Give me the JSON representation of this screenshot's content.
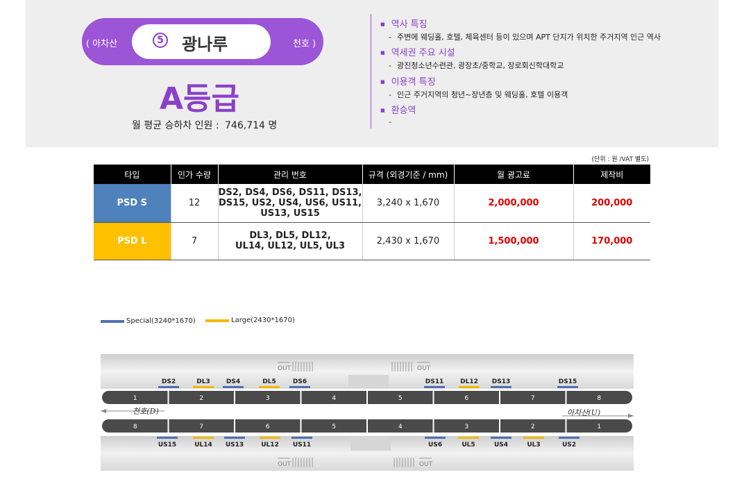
{
  "station": {
    "prev_station": "( 아차산",
    "next_station": "천호 )",
    "number": "5",
    "name": "광나루",
    "grade": "A등급",
    "monthly_riders_label": "월 평균 승하차 인원 :",
    "monthly_riders_value": "746,714 명"
  },
  "info": [
    {
      "title": "역사 특징",
      "desc": "주변에 웨딩홀, 호텔, 체육센터 등이 있으며 APT 단지가 위치한 주거지역 인근 역사"
    },
    {
      "title": "역세권 주요 시설",
      "desc": "광진청소년수련관, 광장초/중학교, 장로회신학대학교"
    },
    {
      "title": "이용객 특징",
      "desc": "인근 주거지역의 청년~장년층 및 웨딩홀, 호텔 이용객"
    },
    {
      "title": "환승역",
      "desc": ""
    }
  ],
  "table": {
    "unit_note": "(단위 : 원 /VAT 별도)",
    "headers": [
      "타입",
      "인가 수량",
      "관리 번호",
      "규격 (외경기준 / mm)",
      "월 광고료",
      "제작비"
    ],
    "rows": [
      {
        "type": "PSD S",
        "qty": "12",
        "codes_1": "DS2, DS4, DS6, DS11, DS13,",
        "codes_2": "DS15, US2, US4, US6, US11,",
        "codes_3": "US13, US15",
        "size": "3,240 x 1,670",
        "monthly_fee": "2,000,000",
        "production_fee": "200,000"
      },
      {
        "type": "PSD L",
        "qty": "7",
        "codes_1": "DL3, DL5, DL12,",
        "codes_2": "UL14, UL12, UL5, UL3",
        "codes_3": "",
        "size": "2,430 x 1,670",
        "monthly_fee": "1,500,000",
        "production_fee": "170,000"
      }
    ]
  },
  "legend": {
    "special": "Special(3240*1670)",
    "large": "Large(2430*1670)",
    "special_color": "#4f6fb0",
    "large_color": "#f5b800"
  },
  "diagram": {
    "out_label": "OUT",
    "dir_down": "천호(D)",
    "dir_up": "아차산(U)",
    "top_labels": [
      {
        "label": "DS2",
        "kind": "special"
      },
      {
        "label": "DL3",
        "kind": "large"
      },
      {
        "label": "DS4",
        "kind": "special"
      },
      {
        "label": "DL5",
        "kind": "large"
      },
      {
        "label": "DS6",
        "kind": "special"
      },
      {
        "label": "DS11",
        "kind": "special"
      },
      {
        "label": "DL12",
        "kind": "large"
      },
      {
        "label": "DS13",
        "kind": "special"
      },
      {
        "label": "DS15",
        "kind": "special"
      }
    ],
    "bottom_labels": [
      {
        "label": "US15",
        "kind": "special"
      },
      {
        "label": "UL14",
        "kind": "large"
      },
      {
        "label": "US13",
        "kind": "special"
      },
      {
        "label": "UL12",
        "kind": "large"
      },
      {
        "label": "US11",
        "kind": "special"
      },
      {
        "label": "US6",
        "kind": "special"
      },
      {
        "label": "UL5",
        "kind": "large"
      },
      {
        "label": "US4",
        "kind": "special"
      },
      {
        "label": "UL3",
        "kind": "large"
      },
      {
        "label": "US2",
        "kind": "special"
      }
    ],
    "top_cars": [
      "1",
      "2",
      "3",
      "4",
      "5",
      "6",
      "7",
      "8"
    ],
    "bottom_cars": [
      "8",
      "7",
      "6",
      "5",
      "4",
      "3",
      "2",
      "1"
    ]
  }
}
